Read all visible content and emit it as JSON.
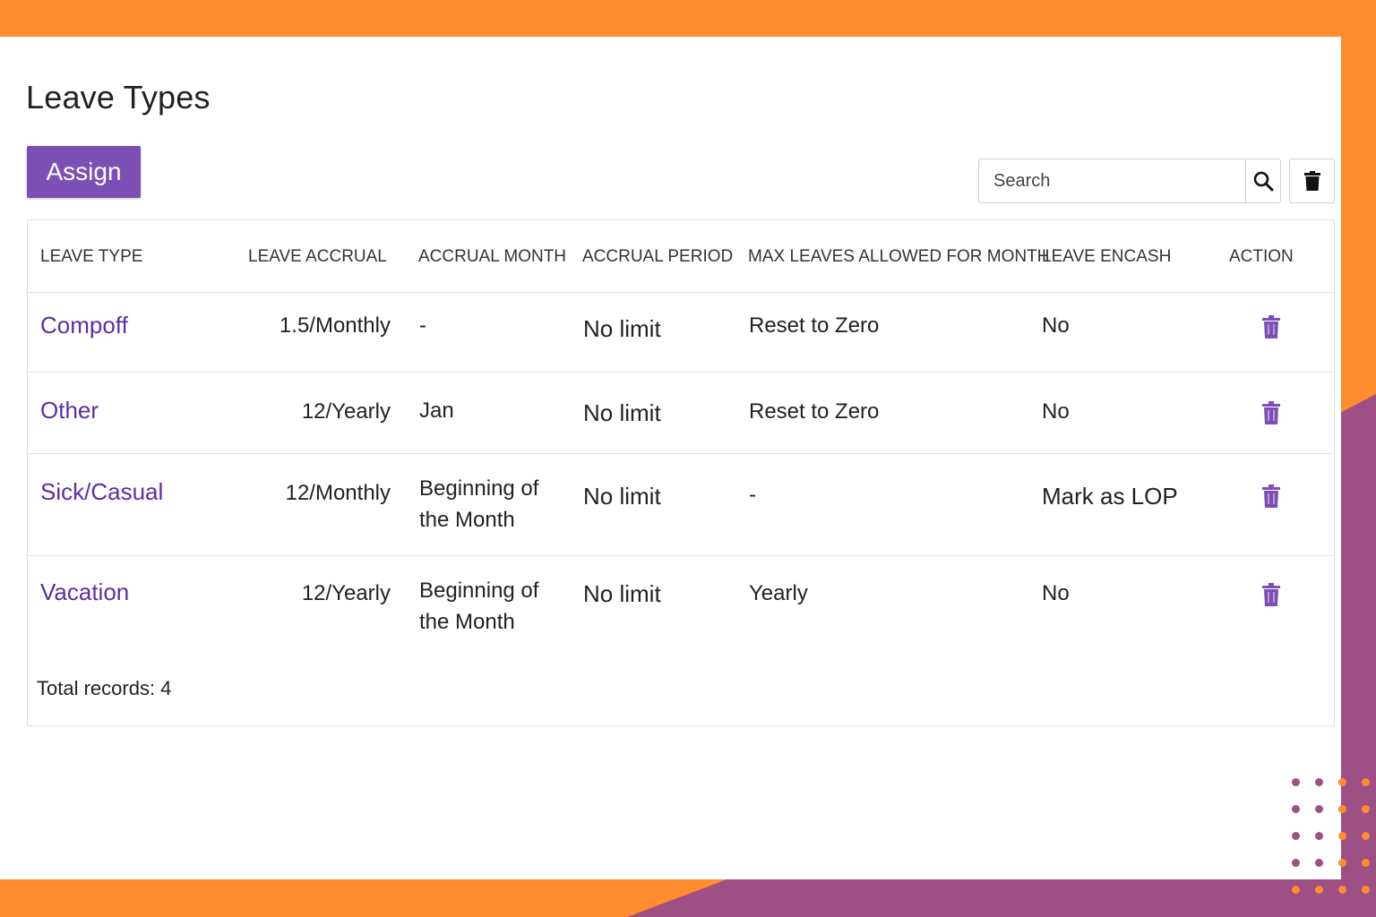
{
  "page": {
    "title": "Leave Types"
  },
  "toolbar": {
    "assign_label": "Assign",
    "search_placeholder": "Search",
    "search_icon": "search-icon",
    "delete_icon": "trash-icon"
  },
  "table": {
    "columns": [
      "LEAVE TYPE",
      "LEAVE ACCRUAL",
      "ACCRUAL MONTH",
      "ACCRUAL PERIOD",
      "MAX LEAVES ALLOWED FOR MONTH",
      "LEAVE ENCASH",
      "ACTION"
    ],
    "rows": [
      {
        "leave_type": "Compoff",
        "leave_accrual": "1.5/Monthly",
        "accrual_month": "-",
        "accrual_period": "No limit",
        "max_leaves": "Reset to Zero",
        "leave_encash": "No"
      },
      {
        "leave_type": "Other",
        "leave_accrual": "12/Yearly",
        "accrual_month": "Jan",
        "accrual_period": "No limit",
        "max_leaves": "Reset to Zero",
        "leave_encash": "No"
      },
      {
        "leave_type": "Sick/Casual",
        "leave_accrual": "12/Monthly",
        "accrual_month": "Beginning of the Month",
        "accrual_period": "No limit",
        "max_leaves": "-",
        "leave_encash": "Mark as LOP"
      },
      {
        "leave_type": "Vacation",
        "leave_accrual": "12/Yearly",
        "accrual_month": "Beginning of the Month",
        "accrual_period": "No limit",
        "max_leaves": "Yearly",
        "leave_encash": "No"
      }
    ],
    "total_records": "Total records: 4"
  },
  "colors": {
    "accent": "#7c4fb5",
    "link": "#5b2ea6",
    "frame_orange": "#ff8c2e",
    "frame_purple": "#9e4f84"
  }
}
